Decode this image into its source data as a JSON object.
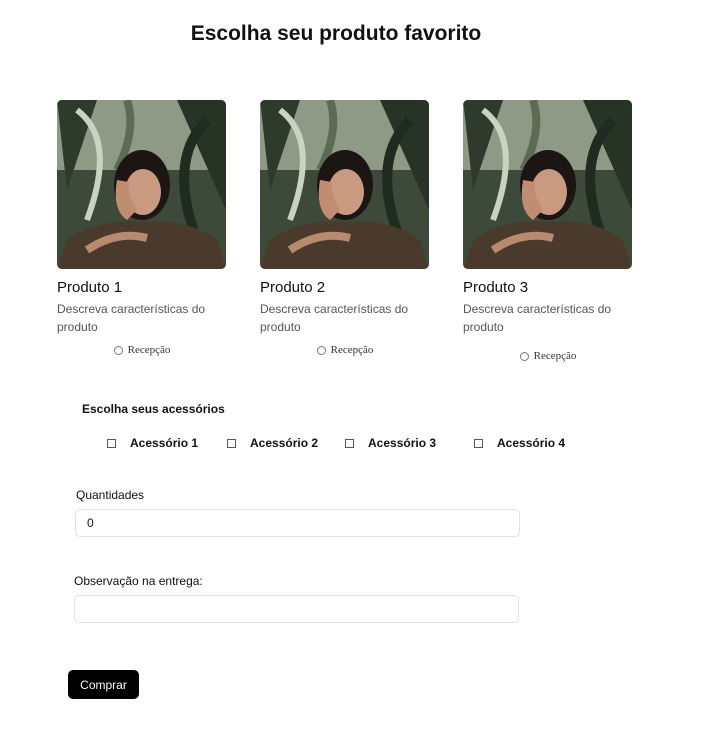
{
  "page": {
    "title": "Escolha seu produto favorito"
  },
  "products": [
    {
      "name": "Produto 1",
      "description": "Descreva características do produto",
      "radio_label": "Recepção"
    },
    {
      "name": "Produto 2",
      "description": "Descreva características do produto",
      "radio_label": "Recepção"
    },
    {
      "name": "Produto 3",
      "description": "Descreva características do produto",
      "radio_label": "Recepção"
    }
  ],
  "accessories": {
    "heading": "Escolha seus acessórios",
    "items": [
      {
        "label": "Acessório 1"
      },
      {
        "label": "Acessório 2"
      },
      {
        "label": "Acessório 3"
      },
      {
        "label": "Acessório 4"
      }
    ]
  },
  "quantity": {
    "label": "Quantidades",
    "value": "0"
  },
  "delivery_note": {
    "label": "Observação na entrega:",
    "value": ""
  },
  "actions": {
    "buy_label": "Comprar"
  },
  "colors": {
    "button_bg": "#000000",
    "button_text": "#ffffff",
    "description_text": "#555555",
    "input_border": "#e2e2e2"
  }
}
